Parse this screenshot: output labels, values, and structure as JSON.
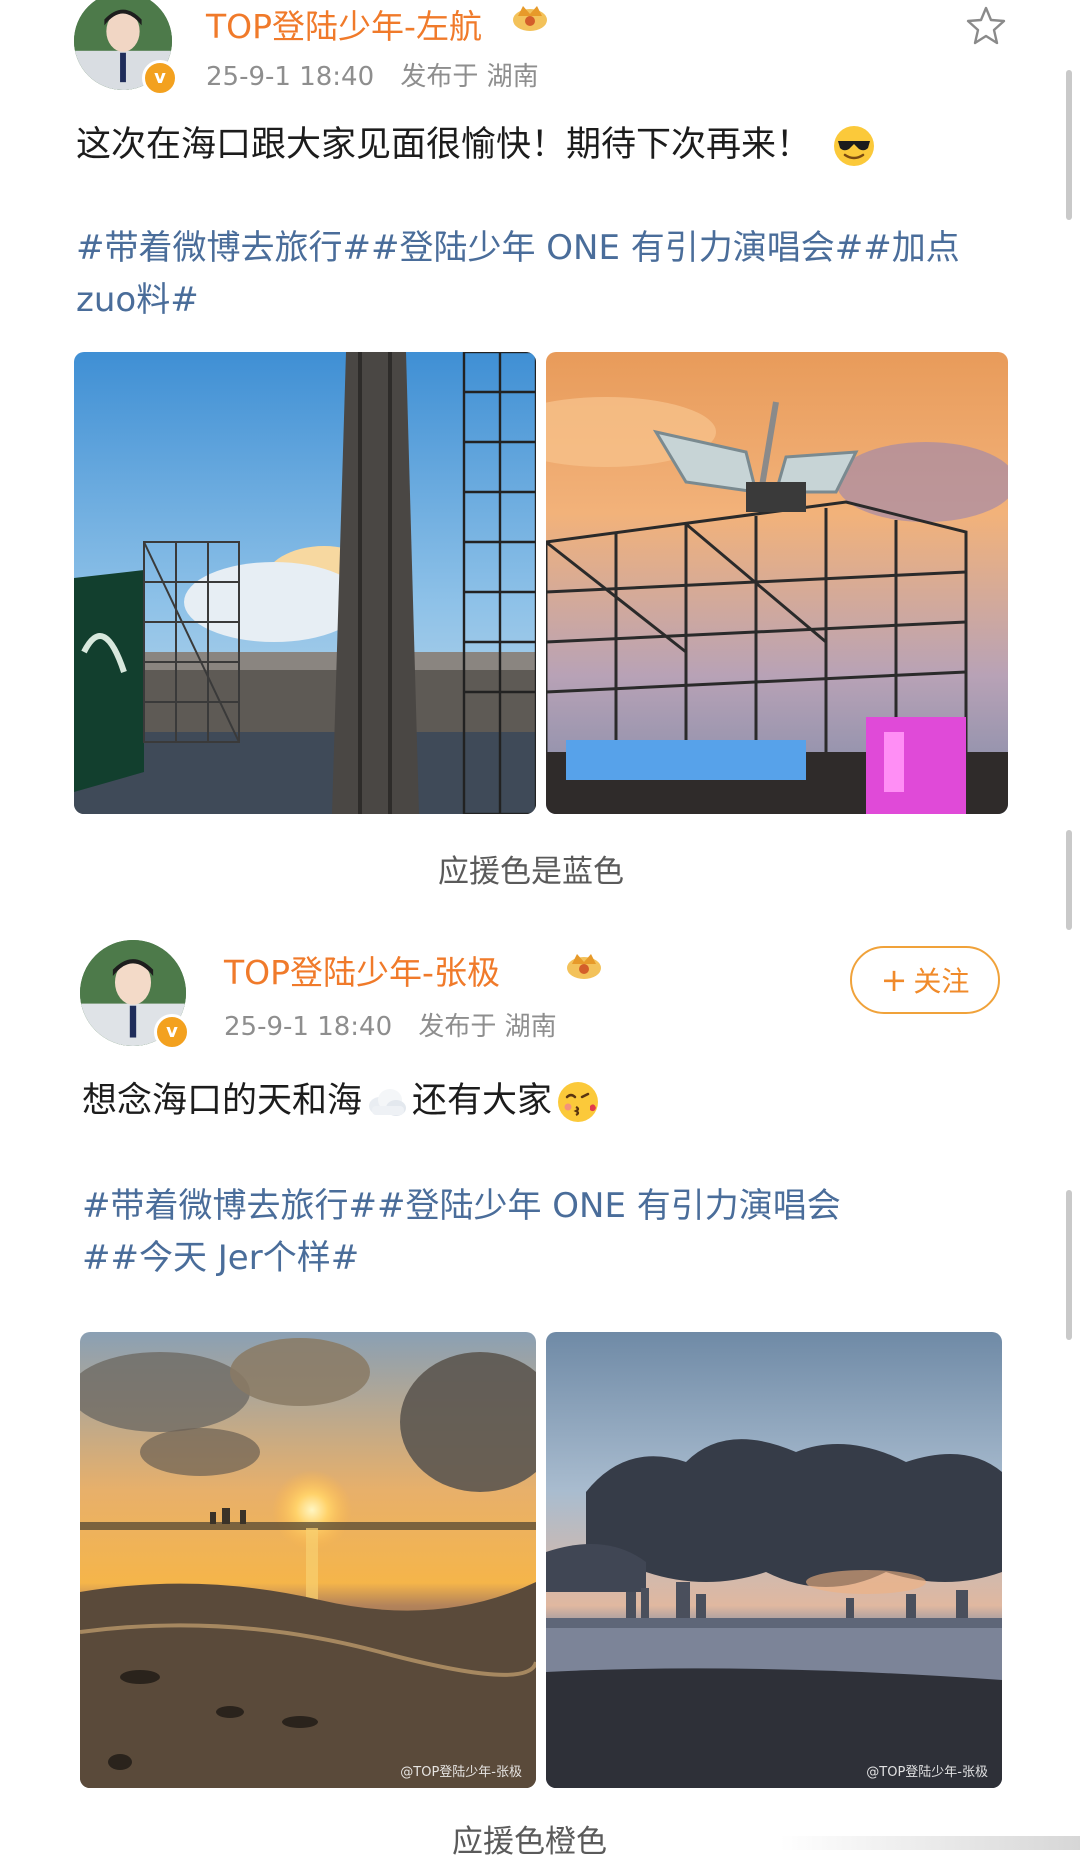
{
  "posts": [
    {
      "user_name": "TOP登陆少年-左航",
      "time": "25-9-1 18:40",
      "location": "发布于 湖南",
      "text": "这次在海口跟大家见面很愉快！期待下次再来！",
      "emoji": "sunglasses-emoji",
      "hashtag_lines": [
        "#带着微博去旅行##登陆少年 ONE 有引力演唱会##加点",
        "zuo料#"
      ],
      "caption": "应援色是蓝色",
      "photos": [
        "stadium-tower-photo",
        "butterfly-stage-photo"
      ]
    },
    {
      "user_name": "TOP登陆少年-张极",
      "time": "25-9-1 18:40",
      "location": "发布于 湖南",
      "follow_label": "关注",
      "follow_plus": "+",
      "text": "想念海口的天和海",
      "text_after_cloud": "还有大家",
      "emoji_cloud": "cloud-emoji",
      "emoji": "kissing-emoji",
      "hashtag_lines": [
        "#带着微博去旅行##登陆少年 ONE 有引力演唱会",
        "##今天 Jer个样#"
      ],
      "caption": "应援色橙色",
      "photos": [
        "sunset-beach-photo",
        "cloudy-coast-photo"
      ],
      "watermarks": [
        "@TOP登陆少年-张极",
        "@TOP登陆少年-张极"
      ]
    }
  ],
  "colors": {
    "user_name": "#f07a2a",
    "hashtag": "#4a6d9a",
    "meta": "#8e8e8e",
    "follow_border": "#f0a23a"
  }
}
